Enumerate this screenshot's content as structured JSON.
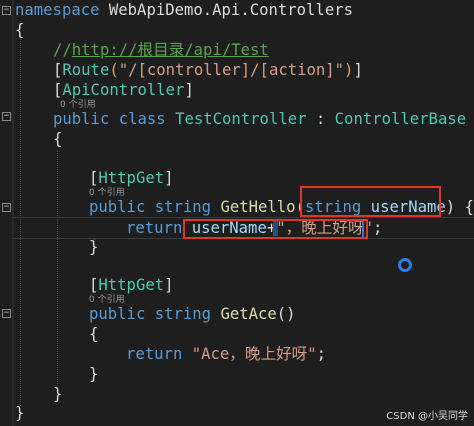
{
  "editor": {
    "lines": {
      "ns_kw": "namespace",
      "ns_name": " WebApiDemo.Api.Controllers",
      "brace_open_1": "{",
      "comment_prefix": "//",
      "comment_url": "http://根目录/api/Test",
      "route_open": "[",
      "route_type": "Route",
      "route_args": "(\"/[controller]/[action]\")",
      "route_close": "]",
      "apictl_open": "[",
      "apictl_type": "ApiController",
      "apictl_close": "]",
      "class_public": "public",
      "class_kw": " class ",
      "class_name": "TestController",
      "class_colon": " : ",
      "class_base": "ControllerBase",
      "brace_open_2": "{",
      "httpget1_open": "[",
      "httpget1_type": "HttpGet",
      "httpget1_close": "]",
      "m1_public": "public",
      "m1_string": " string ",
      "m1_name": "GetHello",
      "m1_paren": "(",
      "m1_ptype": "string",
      "m1_pname": " userName",
      "m1_close": ") {",
      "brace_open_3": "{",
      "ret1_kw": "return",
      "ret1_var": " userName",
      "ret1_plus": "+",
      "ret1_str": "\"，晚上好呀\"",
      "ret1_semi": ";",
      "brace_close_3": "}",
      "httpget2_open": "[",
      "httpget2_type": "HttpGet",
      "httpget2_close": "]",
      "m2_public": "public",
      "m2_string": " string ",
      "m2_name": "GetAce",
      "m2_parens": "()",
      "brace_open_4": "{",
      "ret2_kw": "return",
      "ret2_str": " \"Ace，晚上好呀\"",
      "ret2_semi": ";",
      "brace_close_4": "}",
      "brace_close_2": "}",
      "brace_close_1": "}"
    },
    "codelens": {
      "class_refs": "0 个引用",
      "m1_refs": "0 个引用",
      "m2_refs": "0 个引用"
    },
    "fold_symbol": "−"
  },
  "watermark": "CSDN @小吴同学",
  "colors": {
    "background": "#1e1e1e",
    "keyword": "#569cd6",
    "type": "#4ec9b0",
    "method": "#dcdcaa",
    "string": "#d69d85",
    "comment": "#57a64a",
    "highlight_box": "#e0352b"
  }
}
